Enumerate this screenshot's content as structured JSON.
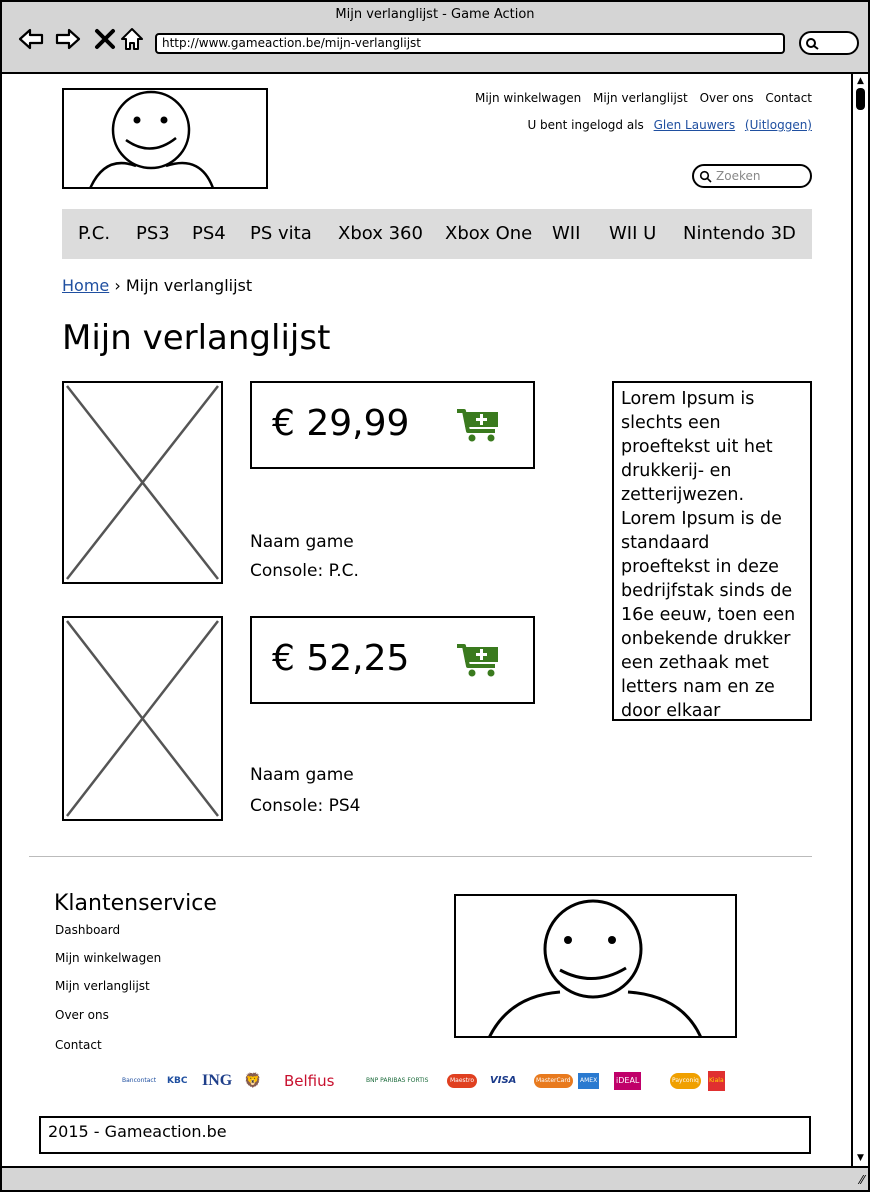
{
  "window": {
    "title": "Mijn verlanglijst - Game Action",
    "url": "http://www.gameaction.be/mijn-verlanglijst"
  },
  "header": {
    "top_links": [
      "Mijn winkelwagen",
      "Mijn verlanglijst",
      "Over ons",
      "Contact"
    ],
    "login_prefix": "U bent ingelogd als",
    "user_name": "Glen Lauwers",
    "logout": "(Uitloggen)",
    "search_placeholder": "Zoeken"
  },
  "catnav": [
    "P.C.",
    "PS3",
    "PS4",
    "PS vita",
    "Xbox 360",
    "Xbox One",
    "WII",
    "WII U",
    "Nintendo 3D"
  ],
  "breadcrumb": {
    "home": "Home",
    "separator": "›",
    "current": "Mijn verlanglijst"
  },
  "page_title": "Mijn verlanglijst",
  "items": [
    {
      "price": "€ 29,99",
      "name": "Naam game",
      "console": "Console: P.C."
    },
    {
      "price": "€ 52,25",
      "name": "Naam game",
      "console": "Console: PS4"
    }
  ],
  "sidebar_text": "Lorem Ipsum is slechts een proeftekst uit het drukkerij- en zetterijwezen. Lorem Ipsum is de standaard proeftekst in deze bedrijfstak sinds de 16e eeuw, toen een onbekende drukker een zethaak met letters nam en ze door elkaar",
  "footer": {
    "title": "Klantenservice",
    "links": [
      "Dashboard",
      "Mijn winkelwagen",
      "Mijn verlanglijst",
      "Over ons",
      "Contact"
    ],
    "payments": [
      "Bancontact",
      "KBC",
      "ING",
      "Belfius",
      "BNP PARIBAS FORTIS",
      "Maestro",
      "VISA",
      "MasterCard",
      "AMEX",
      "iDEAL",
      "Payconiq",
      "Kiala"
    ],
    "copyright": "2015 - Gameaction.be"
  },
  "colors": {
    "link": "#1f4fa0",
    "cart": "#3a7a1e",
    "chrome": "#d5d5d5",
    "nav_bg": "#dcdcdc"
  }
}
